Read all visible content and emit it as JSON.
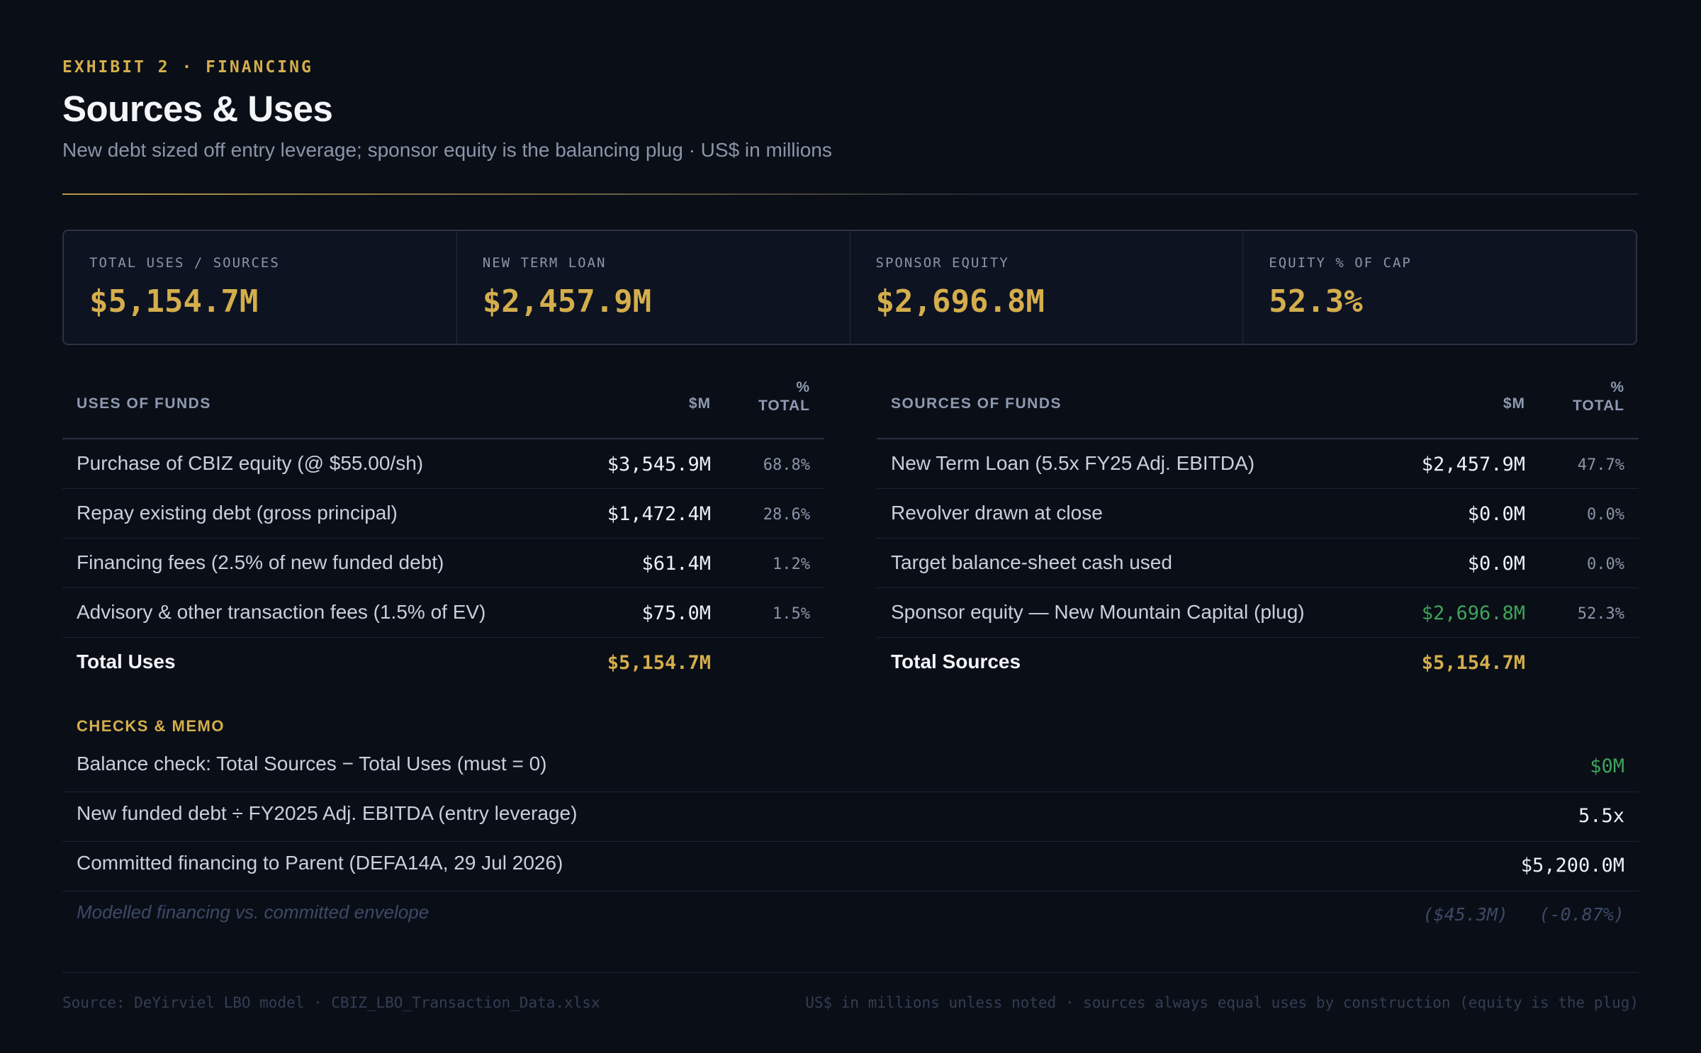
{
  "header": {
    "eyebrow": "EXHIBIT 2 · FINANCING",
    "title": "Sources & Uses",
    "subtitle": "New debt sized off entry leverage; sponsor equity is the balancing plug · US$ in millions"
  },
  "kpis": [
    {
      "label": "TOTAL USES / SOURCES",
      "value": "$5,154.7M"
    },
    {
      "label": "NEW TERM LOAN",
      "value": "$2,457.9M"
    },
    {
      "label": "SPONSOR EQUITY",
      "value": "$2,696.8M"
    },
    {
      "label": "EQUITY % OF CAP",
      "value": "52.3%"
    }
  ],
  "uses": {
    "header": {
      "label": "USES OF FUNDS",
      "amount": "$M",
      "pct_line1": "%",
      "pct_line2": "TOTAL"
    },
    "rows": [
      {
        "label": "Purchase of CBIZ equity (@ $55.00/sh)",
        "amount": "$3,545.9M",
        "pct": "68.8%"
      },
      {
        "label": "Repay existing debt (gross principal)",
        "amount": "$1,472.4M",
        "pct": "28.6%"
      },
      {
        "label": "Financing fees (2.5% of new funded debt)",
        "amount": "$61.4M",
        "pct": "1.2%"
      },
      {
        "label": "Advisory & other transaction fees (1.5% of EV)",
        "amount": "$75.0M",
        "pct": "1.5%"
      }
    ],
    "total": {
      "label": "Total Uses",
      "amount": "$5,154.7M"
    }
  },
  "sources": {
    "header": {
      "label": "SOURCES OF FUNDS",
      "amount": "$M",
      "pct_line1": "%",
      "pct_line2": "TOTAL"
    },
    "rows": [
      {
        "label": "New Term Loan (5.5x FY25 Adj. EBITDA)",
        "amount": "$2,457.9M",
        "pct": "47.7%"
      },
      {
        "label": "Revolver drawn at close",
        "amount": "$0.0M",
        "pct": "0.0%"
      },
      {
        "label": "Target balance‑sheet cash used",
        "amount": "$0.0M",
        "pct": "0.0%"
      },
      {
        "label": "Sponsor equity — New Mountain Capital (plug)",
        "amount": "$2,696.8M",
        "pct": "52.3%"
      }
    ],
    "total": {
      "label": "Total Sources",
      "amount": "$5,154.7M"
    }
  },
  "checks": {
    "title": "CHECKS & MEMO",
    "rows": [
      {
        "label": "Balance check: Total Sources − Total Uses (must = 0)",
        "value": "$0M"
      },
      {
        "label": "New funded debt ÷ FY2025 Adj. EBITDA (entry leverage)",
        "value": "5.5x"
      },
      {
        "label": "Committed financing to Parent (DEFA14A, 29 Jul 2026)",
        "value": "$5,200.0M"
      }
    ],
    "memo": {
      "label": "Modelled financing vs. committed envelope",
      "value1": "($45.3M)",
      "value2": "(-0.87%)"
    }
  },
  "footer": {
    "left": "Source: DeYirviel LBO model · CBIZ_LBO_Transaction_Data.xlsx",
    "right": "US$ in millions unless noted · sources always equal uses by construction (equity is the plug)"
  },
  "colors": {
    "background": "#0a0e17",
    "accent_gold": "#d4ae4c",
    "positive_green": "#3ea45a",
    "muted_text": "#8a95a8"
  }
}
